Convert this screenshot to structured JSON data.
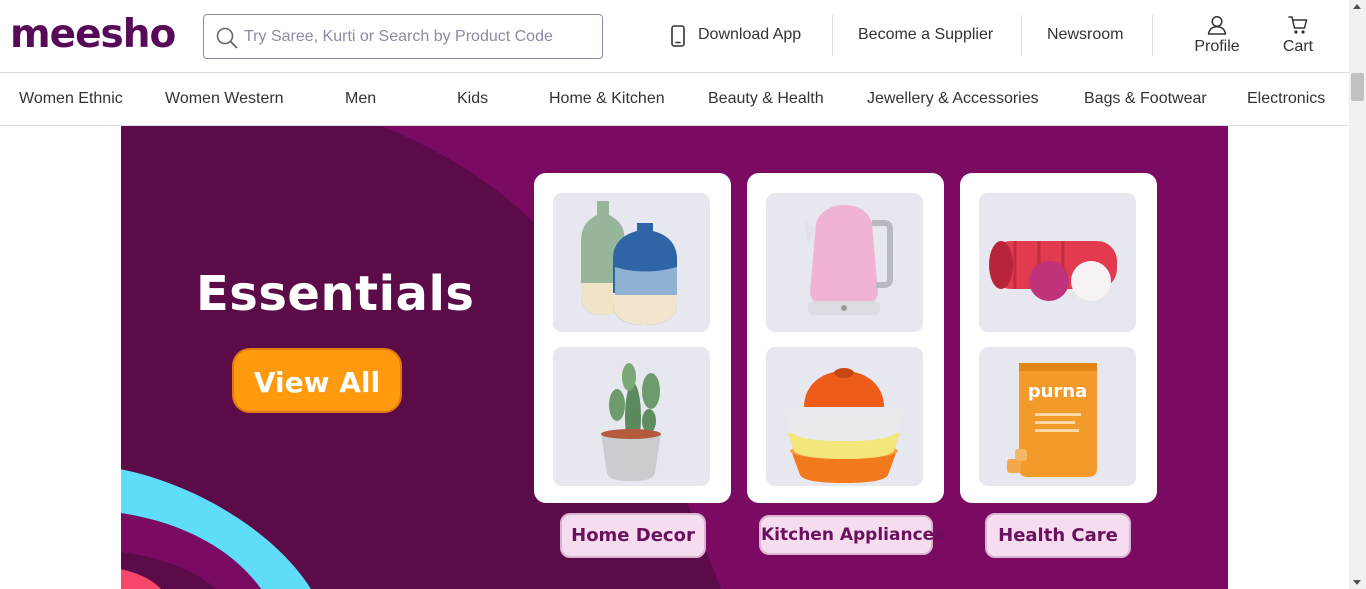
{
  "header": {
    "logo": "meesho",
    "search_placeholder": "Try Saree, Kurti or Search by Product Code",
    "download_app": "Download App",
    "become_supplier": "Become a Supplier",
    "newsroom": "Newsroom",
    "profile": "Profile",
    "cart": "Cart"
  },
  "categories": [
    "Women Ethnic",
    "Women Western",
    "Men",
    "Kids",
    "Home & Kitchen",
    "Beauty & Health",
    "Jewellery & Accessories",
    "Bags & Footwear",
    "Electronics"
  ],
  "banner": {
    "heading": "Essentials",
    "cta": "View All",
    "cards": [
      {
        "label": "Home Decor",
        "items": [
          "vase-image",
          "cactus-plant-image"
        ]
      },
      {
        "label": "Kitchen Appliances",
        "items": [
          "electric-kettle-image",
          "cookware-pots-image"
        ]
      },
      {
        "label": "Health Care",
        "items": [
          "foam-roller-image",
          "supplement-pouch-image"
        ]
      }
    ],
    "pouch_brand": "purna",
    "colors": {
      "banner_bg": "#7a0a62",
      "banner_dark": "#5a0b48",
      "cta_bg": "#ff9a0e",
      "pill_bg": "#f5dcef",
      "pill_text": "#6b0f5e",
      "brand": "#570a57"
    }
  }
}
